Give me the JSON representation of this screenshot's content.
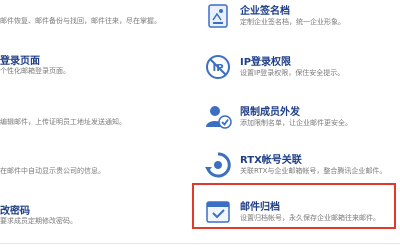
{
  "left_features": [
    {
      "title": "",
      "desc": "邮件恢复、邮件备份与找回，邮件往来，尽在掌握。"
    },
    {
      "title": "登录页面",
      "desc": "个性化邮箱登录页面。"
    },
    {
      "title": "",
      "desc": "编辑邮件，上传证明员工地址发送通知。"
    },
    {
      "title": "",
      "desc": "在邮件中自动显示贵公司的信息。"
    },
    {
      "title": "改密码",
      "desc": "要求成员定期修改密码。"
    }
  ],
  "right_features": [
    {
      "title": "企业签名档",
      "desc": "定制企业签名档，统一企业形象。",
      "icon": "signature-icon"
    },
    {
      "title": "IP登录权限",
      "desc": "设置IP登录权限，保住安全提示。",
      "icon": "ip-restrict-icon"
    },
    {
      "title": "限制成员外发",
      "desc": "添加限制名单，让企业邮件更安全。",
      "icon": "restrict-send-icon"
    },
    {
      "title": "RTX帐号关联",
      "desc": "关联RTX与企业邮箱帐号，整合腾讯企业邮件。",
      "icon": "rtx-link-icon"
    },
    {
      "title": "邮件归档",
      "desc": "设置归档帐号，永久保存企业邮箱往来邮件。",
      "icon": "archive-icon"
    }
  ],
  "colors": {
    "accent": "#1f3f86",
    "highlight": "#e23a2a",
    "icon_blue": "#3a6fc4"
  }
}
